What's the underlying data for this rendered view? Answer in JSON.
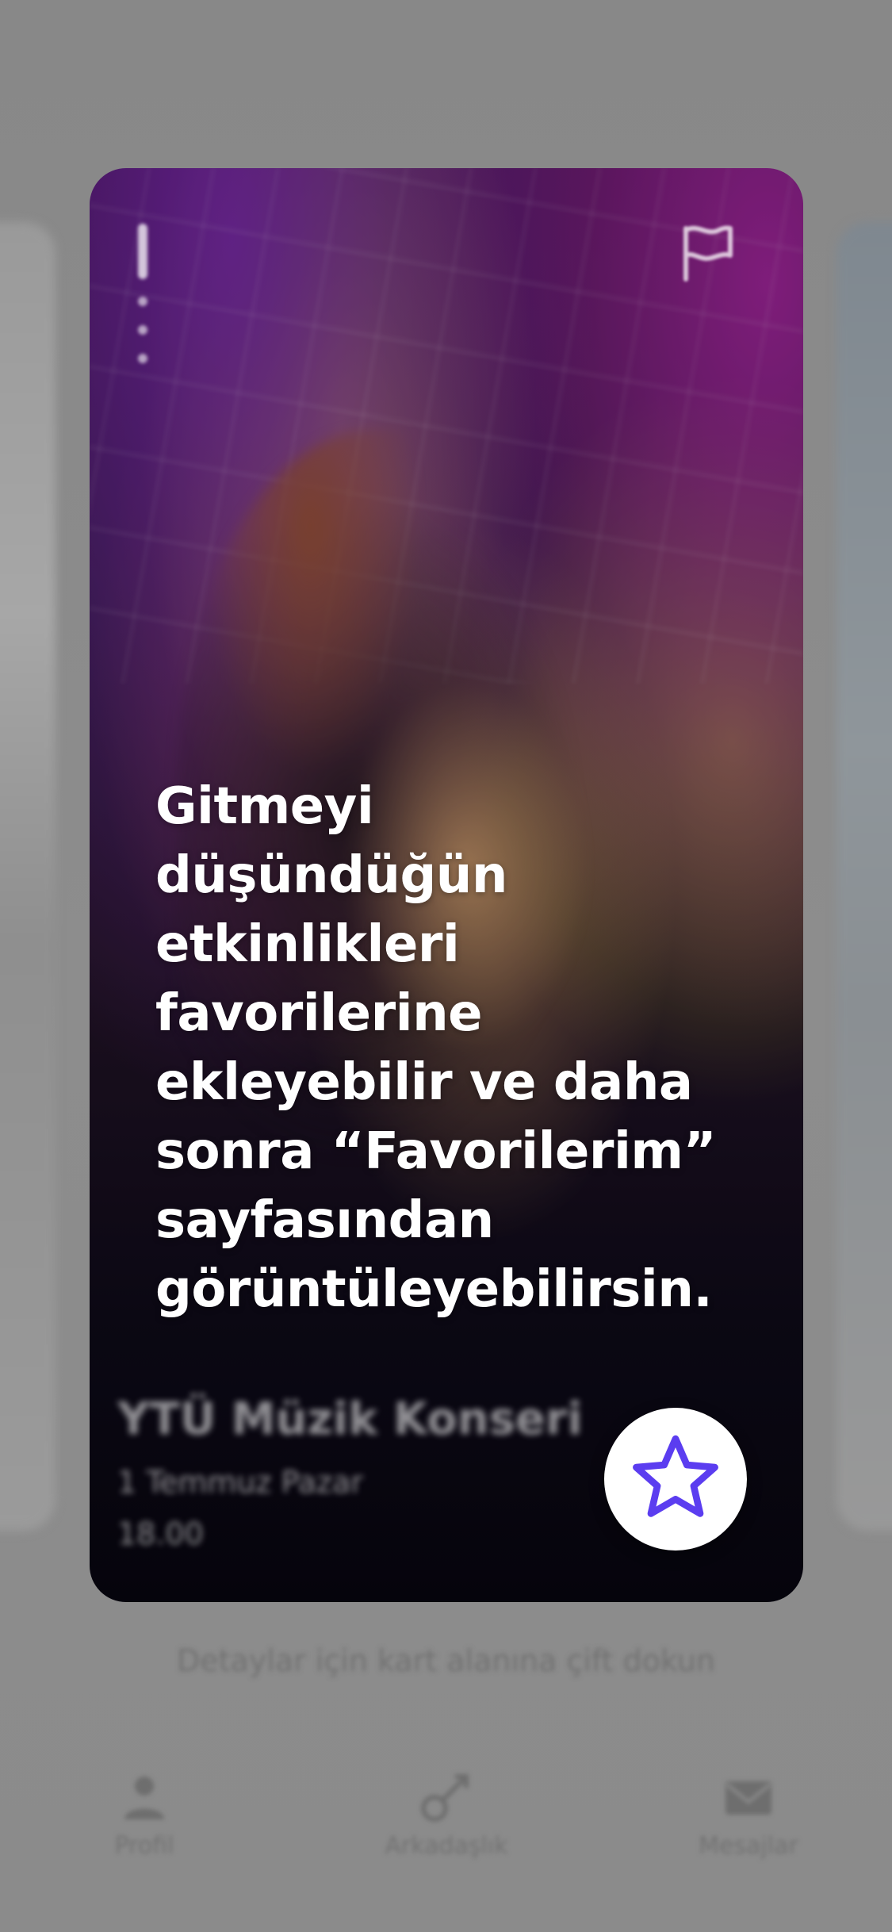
{
  "tooltip": {
    "message": "Gitmeyi\ndüşündüğün\netkinlikleri\nfavorilerine\nekleyebilir ve daha\nsonra “Favorilerim”\nsayfasından\ngörüntüleyebilirsin."
  },
  "event_card": {
    "title": "YTÜ Müzik Konseri",
    "date": "1 Temmuz Pazar",
    "time": "18.00"
  },
  "hint": {
    "text": "Detaylar için kart alanına çift dokun"
  },
  "nav": {
    "items": [
      {
        "label": "Profil",
        "icon": "user-icon"
      },
      {
        "label": "Arkadaşlık",
        "icon": "match-icon"
      },
      {
        "label": "Mesajlar",
        "icon": "mail-icon"
      }
    ]
  },
  "colors": {
    "accent": "#5b3df0",
    "overlay": "#8a8a8a",
    "tooltip_text": "#ffffff"
  }
}
